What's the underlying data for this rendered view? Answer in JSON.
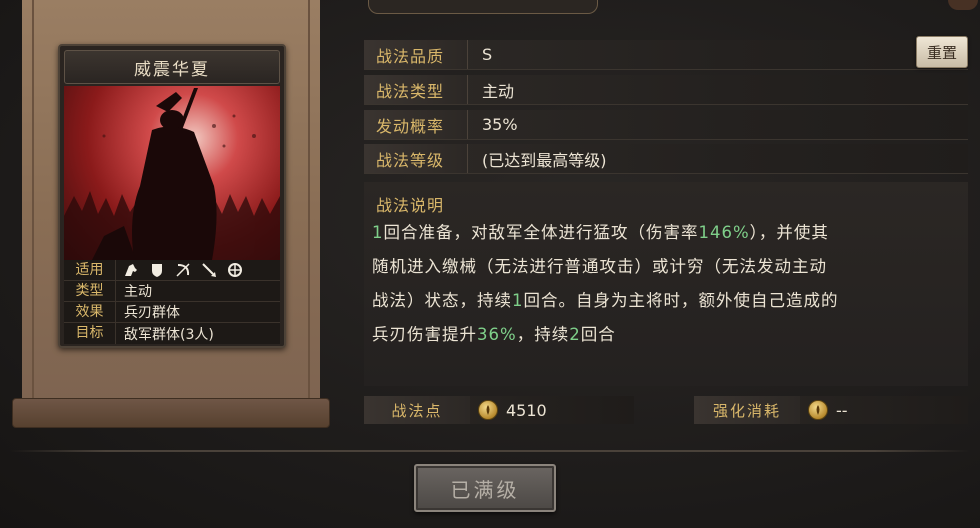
{
  "card": {
    "title": "威震华夏",
    "stats": [
      {
        "key": "适用",
        "value": ""
      },
      {
        "key": "类型",
        "value": "主动"
      },
      {
        "key": "效果",
        "value": "兵刃群体"
      },
      {
        "key": "目标",
        "value": "敌军群体(3人)"
      }
    ],
    "unit_icons": [
      "cavalry-icon",
      "shield-icon",
      "bow-icon",
      "spear-icon",
      "wheel-icon"
    ]
  },
  "info": {
    "quality_label": "战法品质",
    "quality_value": "S",
    "type_label": "战法类型",
    "type_value": "主动",
    "chance_label": "发动概率",
    "chance_value": "35%",
    "level_label": "战法等级",
    "level_value": "(已达到最高等级)"
  },
  "reset_label": "重置",
  "description": {
    "title": "战法说明",
    "line1_a": "1",
    "line1_b": "回合准备，对敌军全体进行猛攻（伤害率",
    "line1_c": "146%",
    "line1_d": "），并使其",
    "line2": "随机进入缴械（无法进行普通攻击）或计穷（无法发动主动",
    "line3_a": "战法）状态，持续",
    "line3_b": "1",
    "line3_c": "回合。自身为主将时，额外使自己造成的",
    "line4_a": "兵刃伤害提升",
    "line4_b": "36%",
    "line4_c": "，持续",
    "line4_d": "2",
    "line4_e": "回合"
  },
  "costs": {
    "points_label": "战法点",
    "points_value": "4510",
    "upgrade_label": "强化消耗",
    "upgrade_value": "--"
  },
  "max_button": "已满级",
  "colors": {
    "gold": "#d9b76a",
    "highlight": "#7fd08a"
  }
}
